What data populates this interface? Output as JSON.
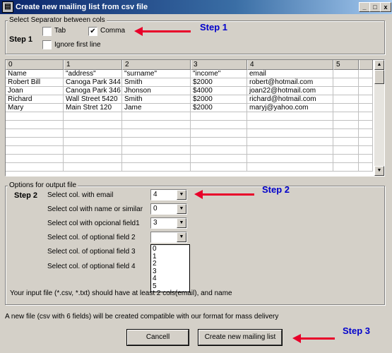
{
  "window": {
    "title": "Create new mailing list from csv file",
    "min_glyph": "_",
    "max_glyph": "□",
    "close_glyph": "x",
    "app_icon": "app-icon"
  },
  "separator": {
    "group_label": "Select Separator between cols",
    "step_label": "Step 1",
    "tab_label": "Tab",
    "tab_checked": false,
    "comma_label": "Comma",
    "comma_checked": true,
    "ignore_label": "Ignore first line",
    "ignore_checked": false
  },
  "annotations": {
    "step1": "Step 1",
    "step2": "Step 2",
    "step3": "Step 3",
    "arrow_color": "#e8002a",
    "step_color": "#0000cc"
  },
  "grid": {
    "headers": [
      "0",
      "1",
      "2",
      "3",
      "4",
      "5",
      ""
    ],
    "rows": [
      [
        "Name",
        "\"address\"",
        "\"surname\"",
        "\"income\"",
        "email",
        "",
        ""
      ],
      [
        "Robert Bill",
        "Canoga Park 344",
        "Smith",
        "$2000",
        " robert@hotmail.com",
        "",
        ""
      ],
      [
        "Joan",
        "Canoga Park 346",
        "Jhonson",
        "$4000",
        " joan22@hotmail.com",
        "",
        ""
      ],
      [
        "Richard",
        "Wall Street 5420",
        "Smith",
        "$2000",
        "richard@hotmail.com",
        "",
        ""
      ],
      [
        "Mary",
        "Main Stret  120",
        "Jame",
        "$2000",
        " maryj@yahoo.com",
        "",
        ""
      ],
      [
        "",
        "",
        "",
        "",
        "",
        "",
        ""
      ],
      [
        "",
        "",
        "",
        "",
        "",
        "",
        ""
      ],
      [
        "",
        "",
        "",
        "",
        "",
        "",
        ""
      ],
      [
        "",
        "",
        "",
        "",
        "",
        "",
        ""
      ],
      [
        "",
        "",
        "",
        "",
        "",
        "",
        ""
      ],
      [
        "",
        "",
        "",
        "",
        "",
        "",
        ""
      ],
      [
        "",
        "",
        "",
        "",
        "",
        "",
        ""
      ]
    ]
  },
  "output": {
    "group_label": "Options for output file",
    "step_label": "Step 2",
    "fields": [
      {
        "label": "Select col. with email",
        "value": "4"
      },
      {
        "label": "Select col with name or similar",
        "value": "0"
      },
      {
        "label": "Select col with opcional field1",
        "value": "3"
      },
      {
        "label": "Select col. of optional field 2",
        "value": ""
      },
      {
        "label": "Select col. of optional field 3",
        "value": ""
      },
      {
        "label": "Select col. of optional field 4",
        "value": ""
      }
    ],
    "dropdown_options": [
      "0",
      "1",
      "2",
      "3",
      "4",
      "5"
    ],
    "note": "Your input file (*.csv, *.txt) should have at least 2 cols(email), and name"
  },
  "footer": {
    "info": "A new file (csv with 6 fields) will be created compatible with our format for mass delivery",
    "cancel_label": "Cancell",
    "create_label": "Create new mailing list"
  }
}
